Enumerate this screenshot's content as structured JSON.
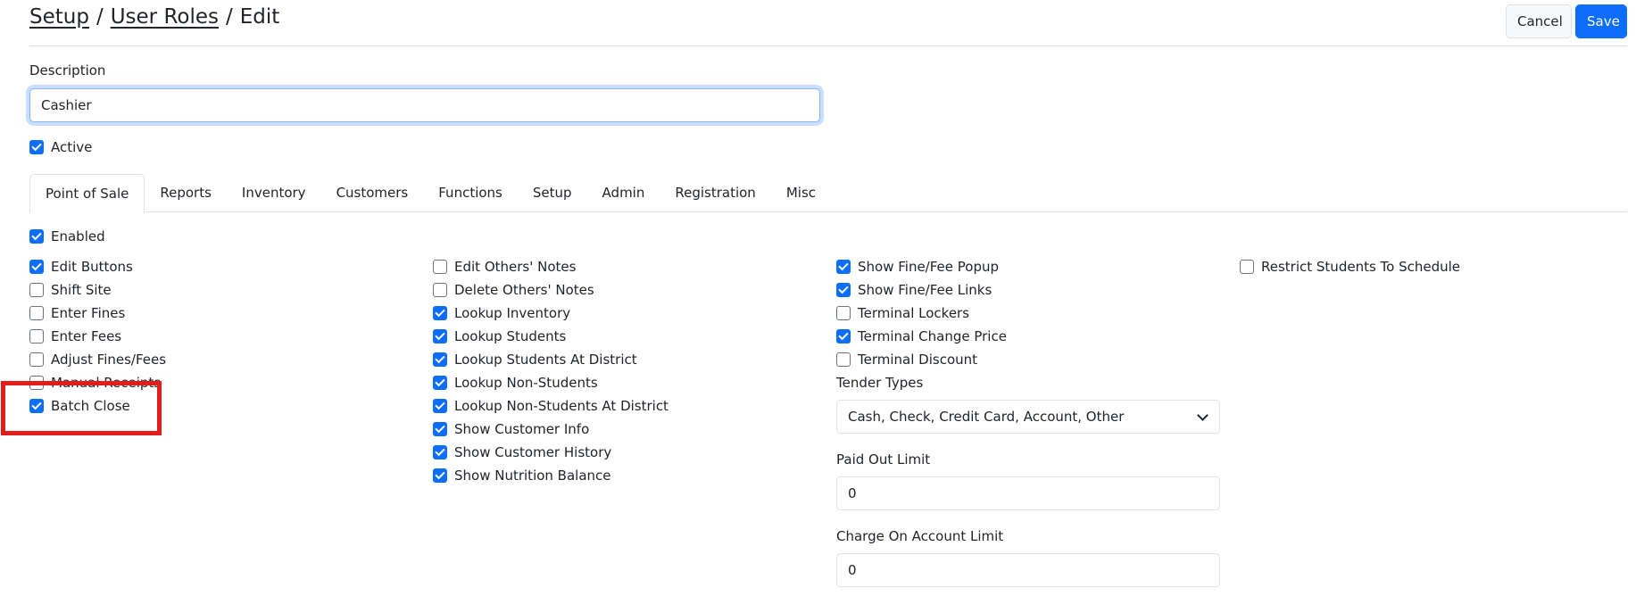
{
  "breadcrumb": {
    "setup": "Setup",
    "user_roles": "User Roles",
    "edit": "Edit",
    "separator": "/"
  },
  "header": {
    "cancel_label": "Cancel",
    "save_label": "Save"
  },
  "description": {
    "label": "Description",
    "value": "Cashier"
  },
  "active": {
    "label": "Active",
    "checked": true
  },
  "tabs": [
    {
      "label": "Point of Sale",
      "active": true
    },
    {
      "label": "Reports"
    },
    {
      "label": "Inventory"
    },
    {
      "label": "Customers"
    },
    {
      "label": "Functions"
    },
    {
      "label": "Setup"
    },
    {
      "label": "Admin"
    },
    {
      "label": "Registration"
    },
    {
      "label": "Misc"
    }
  ],
  "enabled": {
    "label": "Enabled",
    "checked": true
  },
  "col1": [
    {
      "label": "Edit Buttons",
      "checked": true
    },
    {
      "label": "Shift Site",
      "checked": false
    },
    {
      "label": "Enter Fines",
      "checked": false
    },
    {
      "label": "Enter Fees",
      "checked": false
    },
    {
      "label": "Adjust Fines/Fees",
      "checked": false
    },
    {
      "label": "Manual Receipts",
      "checked": false
    },
    {
      "label": "Batch Close",
      "checked": true
    }
  ],
  "col2": [
    {
      "label": "Edit Others' Notes",
      "checked": false
    },
    {
      "label": "Delete Others' Notes",
      "checked": false
    },
    {
      "label": "Lookup Inventory",
      "checked": true
    },
    {
      "label": "Lookup Students",
      "checked": true
    },
    {
      "label": "Lookup Students At District",
      "checked": true
    },
    {
      "label": "Lookup Non-Students",
      "checked": true
    },
    {
      "label": "Lookup Non-Students At District",
      "checked": true
    },
    {
      "label": "Show Customer Info",
      "checked": true
    },
    {
      "label": "Show Customer History",
      "checked": true
    },
    {
      "label": "Show Nutrition Balance",
      "checked": true
    }
  ],
  "col3": [
    {
      "label": "Show Fine/Fee Popup",
      "checked": true
    },
    {
      "label": "Show Fine/Fee Links",
      "checked": true
    },
    {
      "label": "Terminal Lockers",
      "checked": false
    },
    {
      "label": "Terminal Change Price",
      "checked": true
    },
    {
      "label": "Terminal Discount",
      "checked": false
    }
  ],
  "col4": [
    {
      "label": "Restrict Students To Schedule",
      "checked": false
    }
  ],
  "tender_types": {
    "label": "Tender Types",
    "value": "Cash, Check, Credit Card, Account, Other"
  },
  "paid_out_limit": {
    "label": "Paid Out Limit",
    "value": "0"
  },
  "charge_on_account_limit": {
    "label": "Charge On Account Limit",
    "value": "0"
  },
  "colors": {
    "primary": "#0d6efd",
    "highlight": "#e21b1b",
    "border": "#dee2e6"
  }
}
